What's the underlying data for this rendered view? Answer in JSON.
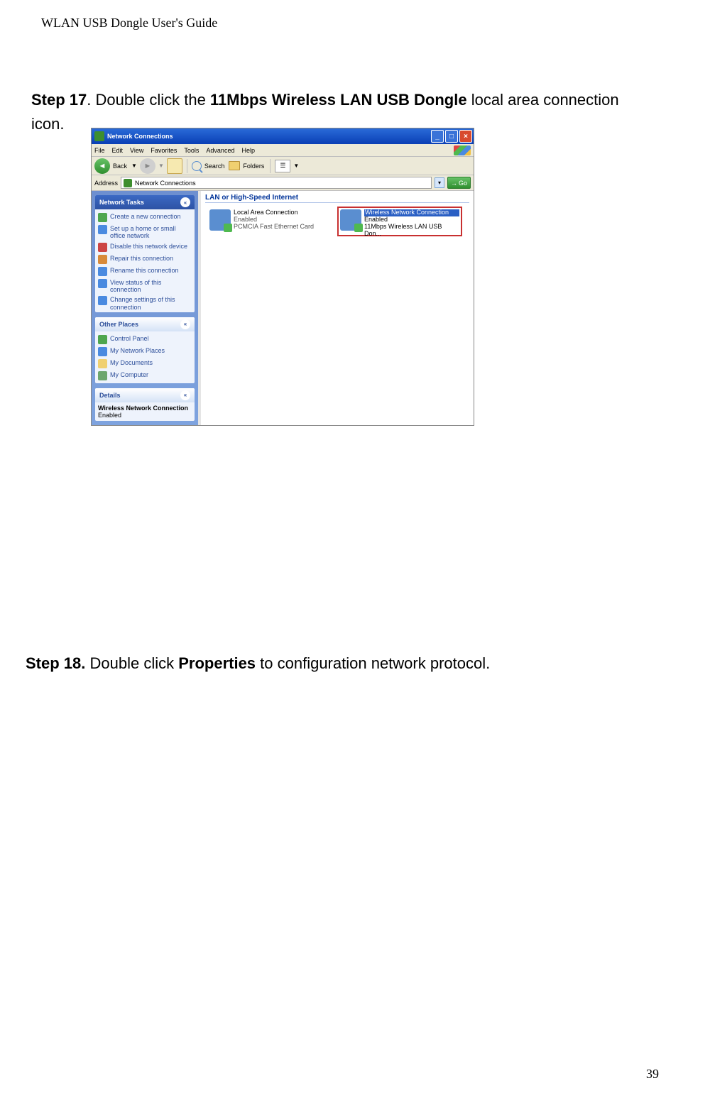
{
  "doc": {
    "header": "WLAN USB Dongle User's Guide",
    "pageNumber": "39"
  },
  "step17": {
    "label": "Step 17",
    "dot": ".",
    "text_a": "    Double click the ",
    "bold": "11Mbps Wireless LAN USB Dongle",
    "text_b": " local area connection icon."
  },
  "step18": {
    "label": "Step 18.",
    "text_a": "     Double click ",
    "bold": "Properties",
    "text_b": " to configuration network protocol."
  },
  "win": {
    "title": "Network Connections",
    "titleButtons": {
      "min": "_",
      "max": "□",
      "close": "×"
    },
    "menu": {
      "file": "File",
      "edit": "Edit",
      "view": "View",
      "favorites": "Favorites",
      "tools": "Tools",
      "advanced": "Advanced",
      "help": "Help"
    },
    "toolbar": {
      "back": "Back",
      "backArrow": "◄",
      "fwdArrow": "►",
      "search": "Search",
      "folders": "Folders",
      "viewsDD": "▼"
    },
    "address": {
      "label": "Address",
      "value": "Network Connections",
      "dd": "▾",
      "go": "Go",
      "goArrow": "→"
    },
    "sidebar": {
      "networkTasks": {
        "title": "Network Tasks",
        "collapse": "«",
        "items": [
          "Create a new connection",
          "Set up a home or small office network",
          "Disable this network device",
          "Repair this connection",
          "Rename this connection",
          "View status of this connection",
          "Change settings of this connection"
        ]
      },
      "otherPlaces": {
        "title": "Other Places",
        "collapse": "«",
        "items": [
          "Control Panel",
          "My Network Places",
          "My Documents",
          "My Computer"
        ]
      },
      "details": {
        "title": "Details",
        "collapse": "«",
        "name": "Wireless Network Connection",
        "status": "Enabled"
      }
    },
    "content": {
      "category": "LAN or High-Speed Internet",
      "conn1": {
        "name": "Local Area Connection",
        "status": "Enabled",
        "device": "PCMCIA Fast Ethernet Card"
      },
      "conn2": {
        "name": "Wireless Network Connection",
        "status": "Enabled",
        "device": "11Mbps Wireless LAN USB Don..."
      }
    }
  }
}
